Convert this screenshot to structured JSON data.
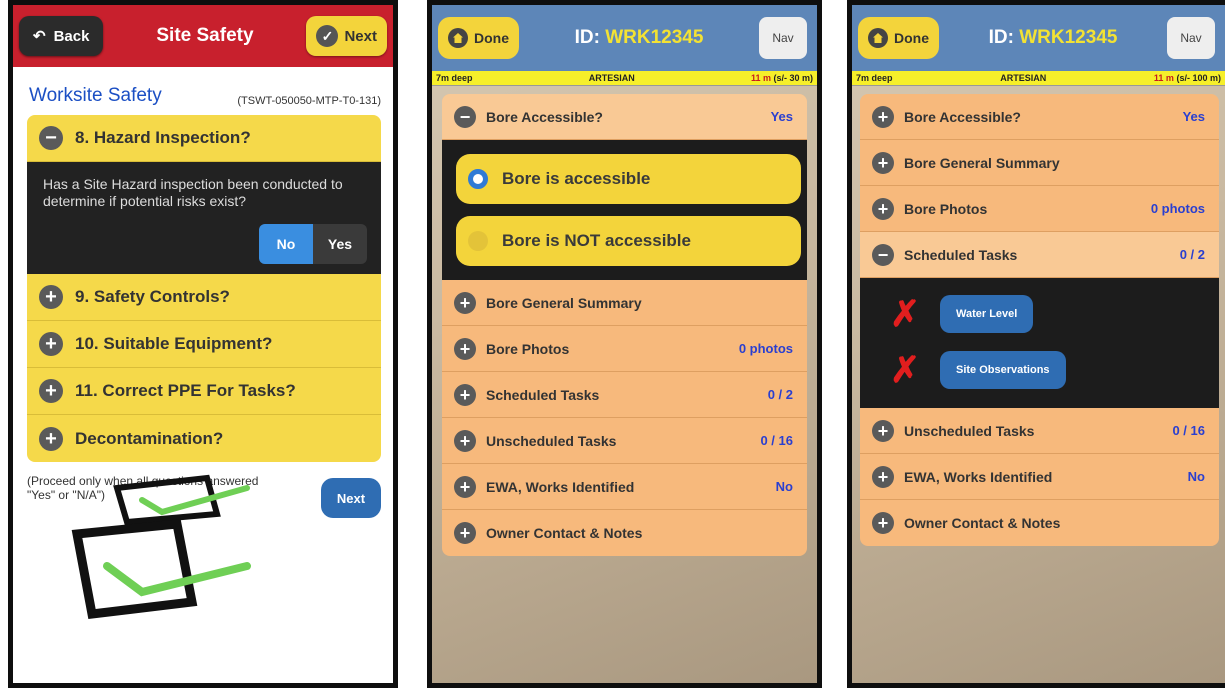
{
  "screen1": {
    "back_label": "Back",
    "title": "Site Safety",
    "next_label": "Next",
    "section_title": "Worksite Safety",
    "section_code": "(TSWT-050050-MTP-T0-131)",
    "questions": [
      {
        "label": "8. Hazard Inspection?",
        "expanded": true
      },
      {
        "label": "9. Safety Controls?"
      },
      {
        "label": "10. Suitable Equipment?"
      },
      {
        "label": "11. Correct PPE For Tasks?"
      },
      {
        "label": "Decontamination?"
      }
    ],
    "question_text": "Has a Site Hazard inspection been conducted to determine if potential risks exist?",
    "answer_no": "No",
    "answer_yes": "Yes",
    "answer_selected": "No",
    "footer_text": "(Proceed only when all questions answered \"Yes\" or \"N/A\")",
    "footer_next": "Next"
  },
  "screen2": {
    "done_label": "Done",
    "id_prefix": "ID:",
    "id_value": "WRK12345",
    "nav_label": "Nav",
    "strip_left": "7m deep",
    "strip_center": "ARTESIAN",
    "strip_right_value": "11 m",
    "strip_right_note": "(s/- 30 m)",
    "accessible_label": "Bore Accessible?",
    "accessible_value": "Yes",
    "options": [
      "Bore is accessible",
      "Bore is NOT accessible"
    ],
    "rows": [
      {
        "label": "Bore General Summary",
        "value": ""
      },
      {
        "label": "Bore Photos",
        "value": "0 photos"
      },
      {
        "label": "Scheduled Tasks",
        "value": "0 / 2"
      },
      {
        "label": "Unscheduled Tasks",
        "value": "0 / 16"
      },
      {
        "label": "EWA, Works Identified",
        "value": "No"
      },
      {
        "label": "Owner Contact & Notes",
        "value": ""
      }
    ]
  },
  "screen3": {
    "done_label": "Done",
    "id_prefix": "ID:",
    "id_value": "WRK12345",
    "nav_label": "Nav",
    "strip_left": "7m deep",
    "strip_center": "ARTESIAN",
    "strip_right_value": "11 m",
    "strip_right_note": "(s/- 100 m)",
    "rows_top": [
      {
        "label": "Bore Accessible?",
        "value": "Yes"
      },
      {
        "label": "Bore General Summary",
        "value": ""
      },
      {
        "label": "Bore Photos",
        "value": "0 photos"
      }
    ],
    "scheduled_label": "Scheduled Tasks",
    "scheduled_value": "0 / 2",
    "tasks": [
      "Water Level",
      "Site Observations"
    ],
    "rows_bottom": [
      {
        "label": "Unscheduled Tasks",
        "value": "0 / 16"
      },
      {
        "label": "EWA, Works Identified",
        "value": "No"
      },
      {
        "label": "Owner Contact & Notes",
        "value": ""
      }
    ]
  },
  "colors": {
    "header_red": "#c8202d",
    "yellow": "#f3d43b",
    "blue_header": "#5d86b8",
    "orange_row": "#f7b97c",
    "value_blue": "#2a3fd0",
    "fail_red": "#e11e1e"
  }
}
